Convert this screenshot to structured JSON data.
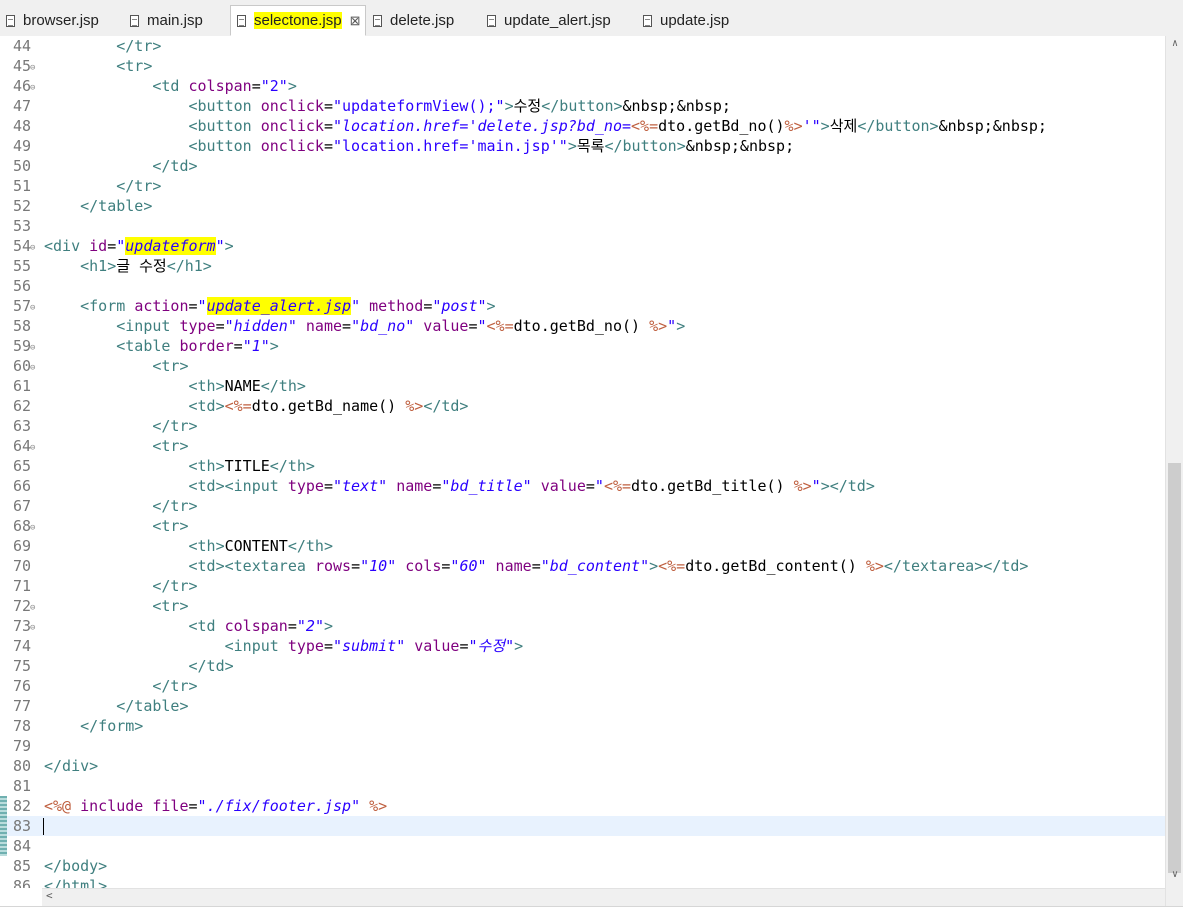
{
  "tabs": [
    {
      "label": "browser.jsp"
    },
    {
      "label": "main.jsp"
    },
    {
      "label": "selectone.jsp",
      "close": "⊠"
    },
    {
      "label": "delete.jsp"
    },
    {
      "label": "update_alert.jsp"
    },
    {
      "label": "update.jsp"
    }
  ],
  "editor": {
    "lines": [
      {
        "n": "44",
        "code": [
          [
            "t",
            "        </tr>"
          ]
        ]
      },
      {
        "n": "45",
        "code": [
          [
            "t",
            "        <tr>"
          ]
        ]
      },
      {
        "n": "46",
        "code": [
          [
            "t",
            "            <td "
          ],
          [
            "a",
            "colspan"
          ],
          [
            "",
            "="
          ],
          [
            "q",
            "\"2\""
          ],
          [
            "t",
            ">"
          ]
        ]
      },
      {
        "n": "47",
        "code": [
          [
            "t",
            "                <button "
          ],
          [
            "a",
            "onclick"
          ],
          [
            "",
            "="
          ],
          [
            "q",
            "\"updateformView();\""
          ],
          [
            "t",
            ">"
          ],
          [
            "",
            "수정"
          ],
          [
            "t",
            "</button>"
          ],
          [
            "",
            "&nbsp;&nbsp;"
          ]
        ]
      },
      {
        "n": "48",
        "code": [
          [
            "t",
            "                <button "
          ],
          [
            "a",
            "onclick"
          ],
          [
            "",
            "="
          ],
          [
            "q",
            "\""
          ],
          [
            "v",
            "location.href='delete.jsp?bd_no="
          ],
          [
            "j",
            "<%="
          ],
          [
            "",
            "dto.getBd_no()"
          ],
          [
            "j",
            "%>"
          ],
          [
            "v",
            "'"
          ],
          [
            "q",
            "\""
          ],
          [
            "t",
            ">"
          ],
          [
            "",
            "삭제"
          ],
          [
            "t",
            "</button>"
          ],
          [
            "",
            "&nbsp;&nbsp;"
          ]
        ]
      },
      {
        "n": "49",
        "code": [
          [
            "t",
            "                <button "
          ],
          [
            "a",
            "onclick"
          ],
          [
            "",
            "="
          ],
          [
            "q",
            "\"location.href='main.jsp'\""
          ],
          [
            "t",
            ">"
          ],
          [
            "",
            "목록"
          ],
          [
            "t",
            "</button>"
          ],
          [
            "",
            "&nbsp;&nbsp;"
          ]
        ]
      },
      {
        "n": "50",
        "code": [
          [
            "t",
            "            </td>"
          ]
        ]
      },
      {
        "n": "51",
        "code": [
          [
            "t",
            "        </tr>"
          ]
        ]
      },
      {
        "n": "52",
        "code": [
          [
            "t",
            "    </table>"
          ]
        ]
      },
      {
        "n": "53",
        "code": []
      },
      {
        "n": "54",
        "code": [
          [
            "t",
            "<div "
          ],
          [
            "a",
            "id"
          ],
          [
            "",
            "="
          ],
          [
            "q",
            "\""
          ],
          [
            "vh",
            "updateform"
          ],
          [
            "q",
            "\""
          ],
          [
            "t",
            ">"
          ]
        ]
      },
      {
        "n": "55",
        "code": [
          [
            "t",
            "    <h1>"
          ],
          [
            "",
            "글 수정"
          ],
          [
            "t",
            "</h1>"
          ]
        ]
      },
      {
        "n": "56",
        "code": []
      },
      {
        "n": "57",
        "code": [
          [
            "t",
            "    <form "
          ],
          [
            "a",
            "action"
          ],
          [
            "",
            "="
          ],
          [
            "q",
            "\""
          ],
          [
            "vh",
            "update_alert.jsp"
          ],
          [
            "q",
            "\""
          ],
          [
            "a",
            " method"
          ],
          [
            "",
            "="
          ],
          [
            "q",
            "\""
          ],
          [
            "v",
            "post"
          ],
          [
            "q",
            "\""
          ],
          [
            "t",
            ">"
          ]
        ]
      },
      {
        "n": "58",
        "code": [
          [
            "t",
            "        <input "
          ],
          [
            "a",
            "type"
          ],
          [
            "",
            "="
          ],
          [
            "q",
            "\""
          ],
          [
            "v",
            "hidden"
          ],
          [
            "q",
            "\""
          ],
          [
            "a",
            " name"
          ],
          [
            "",
            "="
          ],
          [
            "q",
            "\""
          ],
          [
            "v",
            "bd_no"
          ],
          [
            "q",
            "\""
          ],
          [
            "a",
            " value"
          ],
          [
            "",
            "="
          ],
          [
            "q",
            "\""
          ],
          [
            "j",
            "<%="
          ],
          [
            "",
            "dto.getBd_no() "
          ],
          [
            "j",
            "%>"
          ],
          [
            "q",
            "\""
          ],
          [
            "t",
            ">"
          ]
        ]
      },
      {
        "n": "59",
        "code": [
          [
            "t",
            "        <table "
          ],
          [
            "a",
            "border"
          ],
          [
            "",
            "="
          ],
          [
            "q",
            "\""
          ],
          [
            "v",
            "1"
          ],
          [
            "q",
            "\""
          ],
          [
            "t",
            ">"
          ]
        ]
      },
      {
        "n": "60",
        "code": [
          [
            "t",
            "            <tr>"
          ]
        ]
      },
      {
        "n": "61",
        "code": [
          [
            "t",
            "                <th>"
          ],
          [
            "",
            "NAME"
          ],
          [
            "t",
            "</th>"
          ]
        ]
      },
      {
        "n": "62",
        "code": [
          [
            "t",
            "                <td>"
          ],
          [
            "j",
            "<%="
          ],
          [
            "",
            "dto.getBd_name() "
          ],
          [
            "j",
            "%>"
          ],
          [
            "t",
            "</td>"
          ]
        ]
      },
      {
        "n": "63",
        "code": [
          [
            "t",
            "            </tr>"
          ]
        ]
      },
      {
        "n": "64",
        "code": [
          [
            "t",
            "            <tr>"
          ]
        ]
      },
      {
        "n": "65",
        "code": [
          [
            "t",
            "                <th>"
          ],
          [
            "",
            "TITLE"
          ],
          [
            "t",
            "</th>"
          ]
        ]
      },
      {
        "n": "66",
        "code": [
          [
            "t",
            "                <td><input "
          ],
          [
            "a",
            "type"
          ],
          [
            "",
            "="
          ],
          [
            "q",
            "\""
          ],
          [
            "v",
            "text"
          ],
          [
            "q",
            "\""
          ],
          [
            "a",
            " name"
          ],
          [
            "",
            "="
          ],
          [
            "q",
            "\""
          ],
          [
            "v",
            "bd_title"
          ],
          [
            "q",
            "\""
          ],
          [
            "a",
            " value"
          ],
          [
            "",
            "="
          ],
          [
            "q",
            "\""
          ],
          [
            "j",
            "<%="
          ],
          [
            "",
            "dto.getBd_title() "
          ],
          [
            "j",
            "%>"
          ],
          [
            "q",
            "\""
          ],
          [
            "t",
            "></td>"
          ]
        ]
      },
      {
        "n": "67",
        "code": [
          [
            "t",
            "            </tr>"
          ]
        ]
      },
      {
        "n": "68",
        "code": [
          [
            "t",
            "            <tr>"
          ]
        ]
      },
      {
        "n": "69",
        "code": [
          [
            "t",
            "                <th>"
          ],
          [
            "",
            "CONTENT"
          ],
          [
            "t",
            "</th>"
          ]
        ]
      },
      {
        "n": "70",
        "code": [
          [
            "t",
            "                <td><textarea "
          ],
          [
            "a",
            "rows"
          ],
          [
            "",
            "="
          ],
          [
            "q",
            "\""
          ],
          [
            "v",
            "10"
          ],
          [
            "q",
            "\""
          ],
          [
            "a",
            " cols"
          ],
          [
            "",
            "="
          ],
          [
            "q",
            "\""
          ],
          [
            "v",
            "60"
          ],
          [
            "q",
            "\""
          ],
          [
            "a",
            " name"
          ],
          [
            "",
            "="
          ],
          [
            "q",
            "\""
          ],
          [
            "v",
            "bd_content"
          ],
          [
            "q",
            "\""
          ],
          [
            "t",
            ">"
          ],
          [
            "j",
            "<%="
          ],
          [
            "",
            "dto.getBd_content() "
          ],
          [
            "j",
            "%>"
          ],
          [
            "t",
            "</textarea></td>"
          ]
        ]
      },
      {
        "n": "71",
        "code": [
          [
            "t",
            "            </tr>"
          ]
        ]
      },
      {
        "n": "72",
        "code": [
          [
            "t",
            "            <tr>"
          ]
        ]
      },
      {
        "n": "73",
        "code": [
          [
            "t",
            "                <td "
          ],
          [
            "a",
            "colspan"
          ],
          [
            "",
            "="
          ],
          [
            "q",
            "\""
          ],
          [
            "v",
            "2"
          ],
          [
            "q",
            "\""
          ],
          [
            "t",
            ">"
          ]
        ]
      },
      {
        "n": "74",
        "code": [
          [
            "t",
            "                    <input "
          ],
          [
            "a",
            "type"
          ],
          [
            "",
            "="
          ],
          [
            "q",
            "\""
          ],
          [
            "v",
            "submit"
          ],
          [
            "q",
            "\""
          ],
          [
            "a",
            " value"
          ],
          [
            "",
            "="
          ],
          [
            "q",
            "\""
          ],
          [
            "v",
            "수정"
          ],
          [
            "q",
            "\""
          ],
          [
            "t",
            ">"
          ]
        ]
      },
      {
        "n": "75",
        "code": [
          [
            "t",
            "                </td>"
          ]
        ]
      },
      {
        "n": "76",
        "code": [
          [
            "t",
            "            </tr>"
          ]
        ]
      },
      {
        "n": "77",
        "code": [
          [
            "t",
            "        </table>"
          ]
        ]
      },
      {
        "n": "78",
        "code": [
          [
            "t",
            "    </form>"
          ]
        ]
      },
      {
        "n": "79",
        "code": []
      },
      {
        "n": "80",
        "code": [
          [
            "t",
            "</div>"
          ]
        ]
      },
      {
        "n": "81",
        "code": []
      },
      {
        "n": "82",
        "code": [
          [
            "j",
            "<%@ "
          ],
          [
            "a",
            "include"
          ],
          [
            "a",
            " file"
          ],
          [
            "",
            "="
          ],
          [
            "q",
            "\""
          ],
          [
            "v",
            "./fix/footer.jsp"
          ],
          [
            "q",
            "\""
          ],
          [
            "j",
            " %>"
          ]
        ]
      },
      {
        "n": "83",
        "code": []
      },
      {
        "n": "84",
        "code": []
      },
      {
        "n": "85",
        "code": [
          [
            "t",
            "</body>"
          ]
        ]
      },
      {
        "n": "86",
        "code": [
          [
            "t",
            "</html>"
          ]
        ]
      }
    ]
  }
}
